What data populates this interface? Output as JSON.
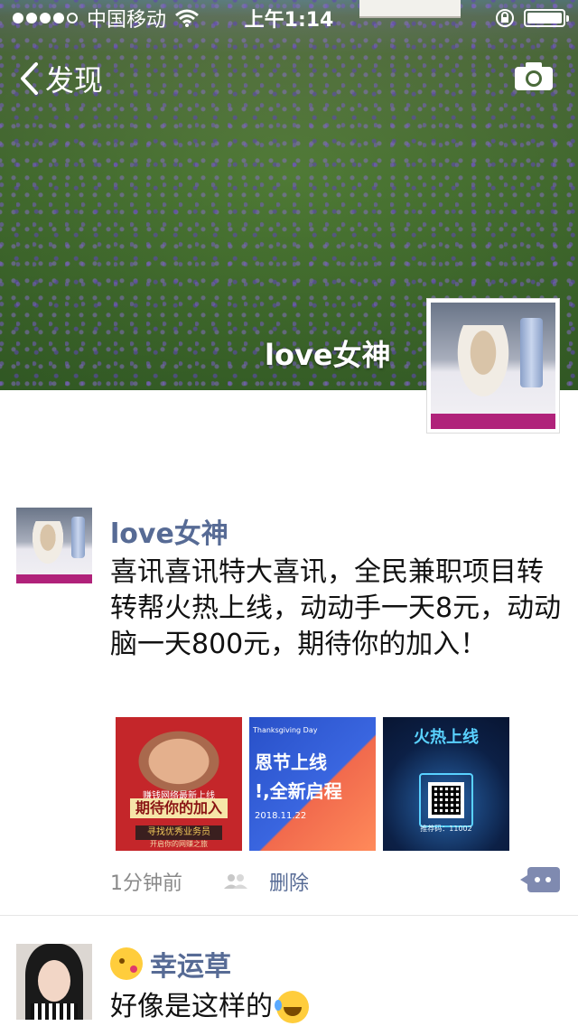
{
  "status_bar": {
    "carrier": "中国移动",
    "time": "上午1:14"
  },
  "nav": {
    "back_label": "发现"
  },
  "profile": {
    "name": "love女神"
  },
  "posts": [
    {
      "author": "love女神",
      "text": "喜讯喜讯特大喜讯，全民兼职项目转转帮火热上线，动动手一天8元，动动脑一天800元，期待你的加入！",
      "photos": [
        {
          "line1": "赚钱网络最新上线",
          "line2": "期待你的加入",
          "line3": "寻找优秀业务员",
          "line4": "开启你的网赚之旅"
        },
        {
          "line1": "Thanksgiving Day",
          "line2": "恩节上线",
          "line3": "!,全新启程",
          "line4": "2018.11.22"
        },
        {
          "line1": "火热上线",
          "line2": "推荐码：11002"
        }
      ],
      "time": "1分钟前",
      "delete_label": "删除"
    },
    {
      "author": "幸运草",
      "text": "好像是这样的"
    }
  ]
}
